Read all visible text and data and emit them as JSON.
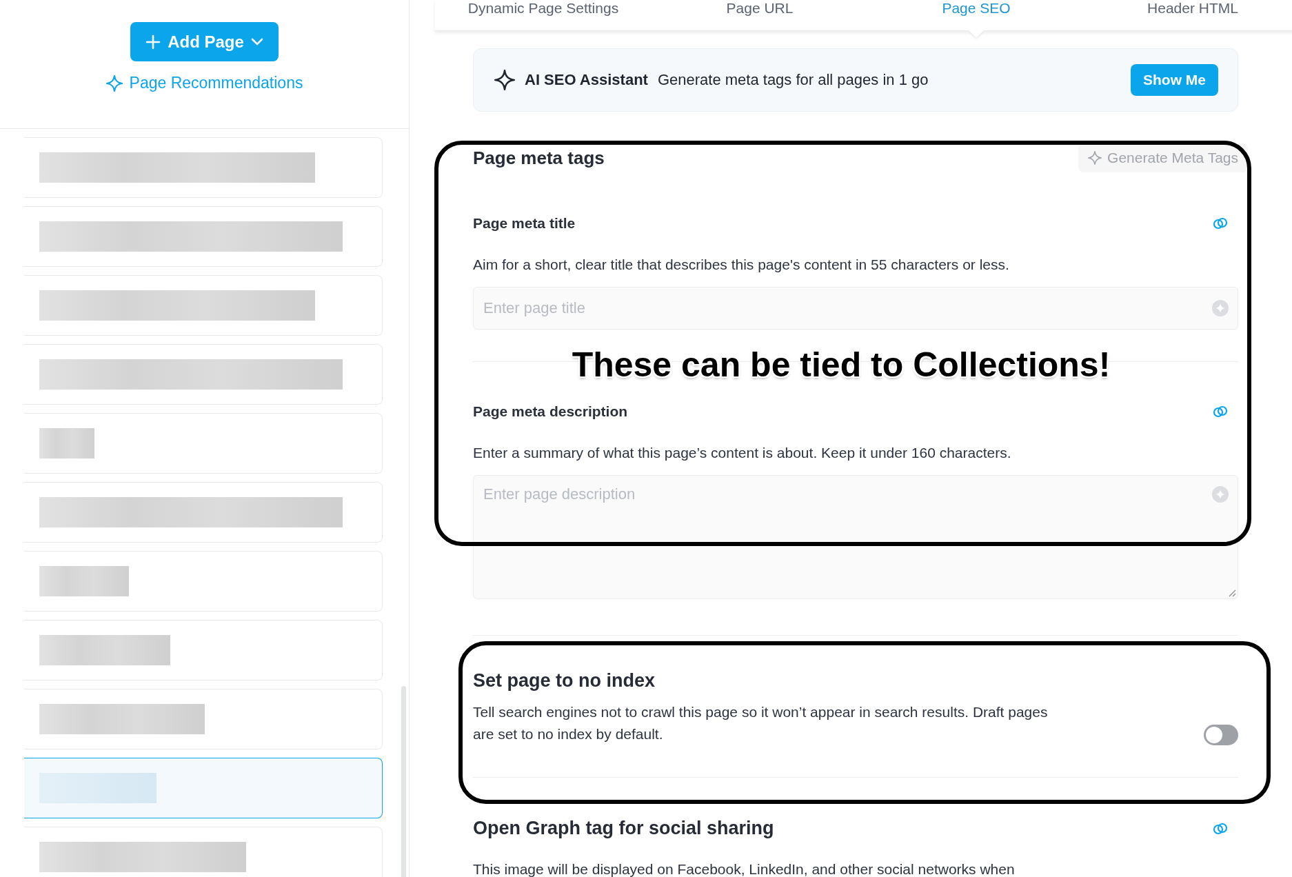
{
  "sidebar": {
    "add_button": "Add Page",
    "recommendations_link": "Page Recommendations",
    "page_items": [
      {
        "selected": false
      },
      {
        "selected": false
      },
      {
        "selected": false
      },
      {
        "selected": false
      },
      {
        "selected": false
      },
      {
        "selected": false
      },
      {
        "selected": false
      },
      {
        "selected": false
      },
      {
        "selected": false
      },
      {
        "selected": true
      },
      {
        "selected": false
      }
    ]
  },
  "tabs": [
    {
      "label": "Dynamic Page Settings",
      "selected": false
    },
    {
      "label": "Page URL",
      "selected": false
    },
    {
      "label": "Page SEO",
      "selected": true
    },
    {
      "label": "Header HTML",
      "selected": false
    }
  ],
  "ai_banner": {
    "title": "AI SEO Assistant",
    "text": "Generate meta tags for all pages in 1 go",
    "button": "Show Me"
  },
  "meta_tags": {
    "heading": "Page meta tags",
    "generate_button": "Generate Meta Tags",
    "fields": [
      {
        "kind": "input",
        "label": "Page meta title",
        "hint": "Aim for a short, clear title that describes this page's content in 55 characters or less.",
        "placeholder": "Enter page title"
      },
      {
        "kind": "textarea",
        "label": "Page meta description",
        "hint": "Enter a summary of what this page’s content is about. Keep it under 160 characters.",
        "placeholder": "Enter page description"
      }
    ]
  },
  "no_index": {
    "heading": "Set page to no index",
    "text": "Tell search engines not to crawl this page so it won’t appear in search results. Draft pages are set to no index by default.",
    "on": false
  },
  "open_graph": {
    "heading": "Open Graph tag for social sharing",
    "text": "This image will be displayed on Facebook, LinkedIn, and other social networks when"
  },
  "annotation": {
    "text": "These can be tied to Collections!"
  }
}
